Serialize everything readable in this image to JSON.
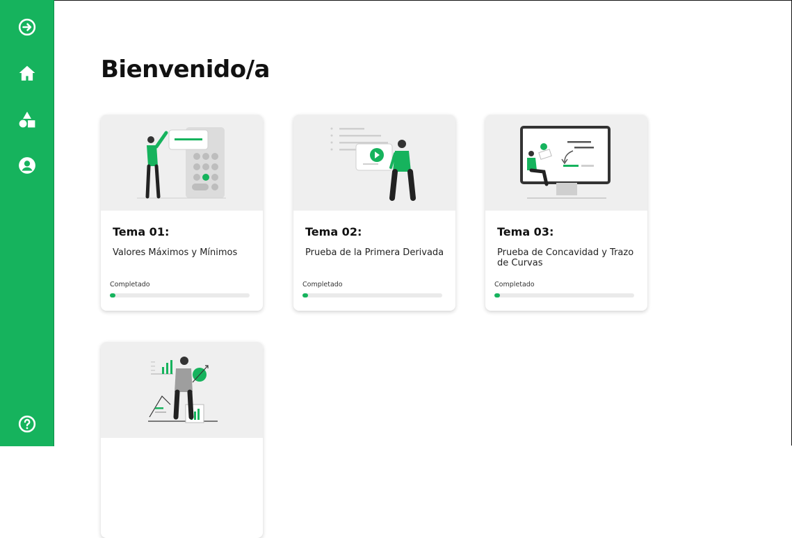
{
  "page": {
    "title": "Bienvenido/a"
  },
  "sidebar": {
    "items": [
      {
        "icon": "arrow-right-circle-icon"
      },
      {
        "icon": "home-icon"
      },
      {
        "icon": "shapes-icon"
      },
      {
        "icon": "user-circle-icon"
      },
      {
        "icon": "help-circle-icon"
      }
    ]
  },
  "colors": {
    "accent": "#16b35d",
    "card_illustration_bg": "#efefef",
    "progress_track": "#eaeaea"
  },
  "topics": [
    {
      "name": "Tema 01:",
      "description": "Valores Máximos y Mínimos",
      "progress_label": "Completado",
      "progress": 0.04
    },
    {
      "name": "Tema 02:",
      "description": "Prueba de la Primera Derivada",
      "progress_label": "Completado",
      "progress": 0.04
    },
    {
      "name": "Tema 03:",
      "description": "Prueba de Concavidad y Trazo de Curvas",
      "progress_label": "Completado",
      "progress": 0.04
    },
    {
      "name": "",
      "description": "",
      "progress_label": "",
      "progress": 0
    }
  ]
}
